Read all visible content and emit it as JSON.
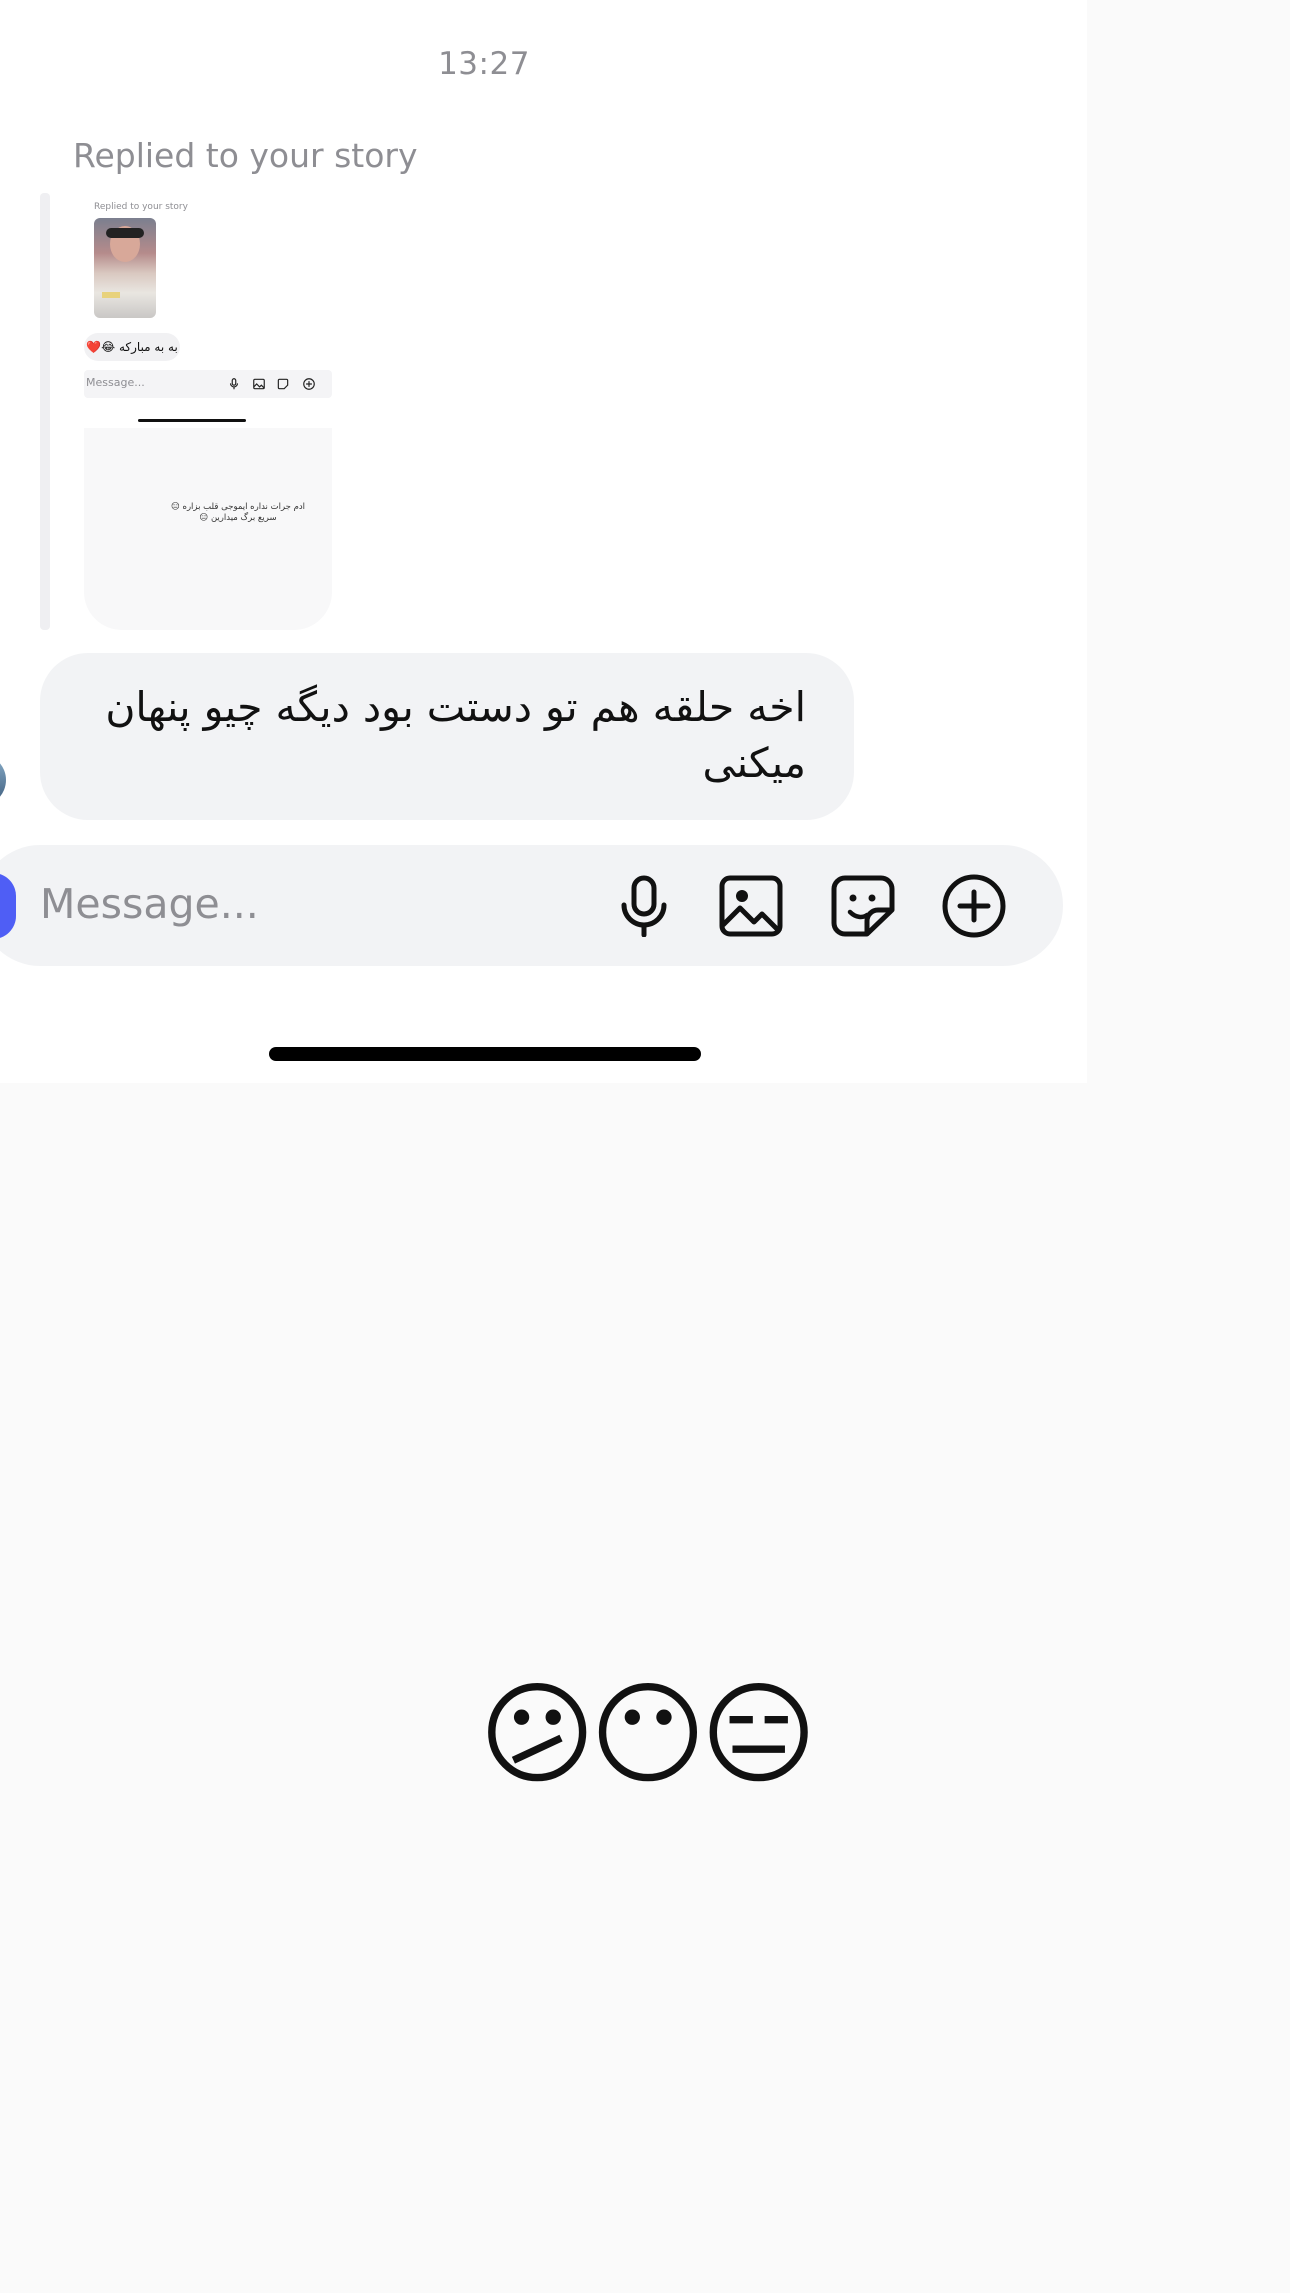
{
  "thread": {
    "timestamp": "13:27",
    "replied_label": "Replied to your story"
  },
  "story_preview": {
    "replied_label": "Replied to your story",
    "bubble_text": "به به مبارکه 😂❤️",
    "input_placeholder": "Message...",
    "caption": "ادم جرات نداره ایموجی قلب بزاره 😑 سریع برگ میدارین 😑"
  },
  "message": {
    "text": "اخه حلقه هم تو دستت بود دیگه چیو پنهان میکنی"
  },
  "composer": {
    "placeholder": "Message...",
    "icons": [
      "microphone-icon",
      "image-icon",
      "sticker-icon",
      "plus-circle-icon"
    ]
  },
  "overlay": {
    "emojis": "😕😶😑"
  },
  "colors": {
    "bubble_bg": "#f2f3f5",
    "camera_accent": "#4f5ef5",
    "muted_text": "#8e8e93"
  }
}
